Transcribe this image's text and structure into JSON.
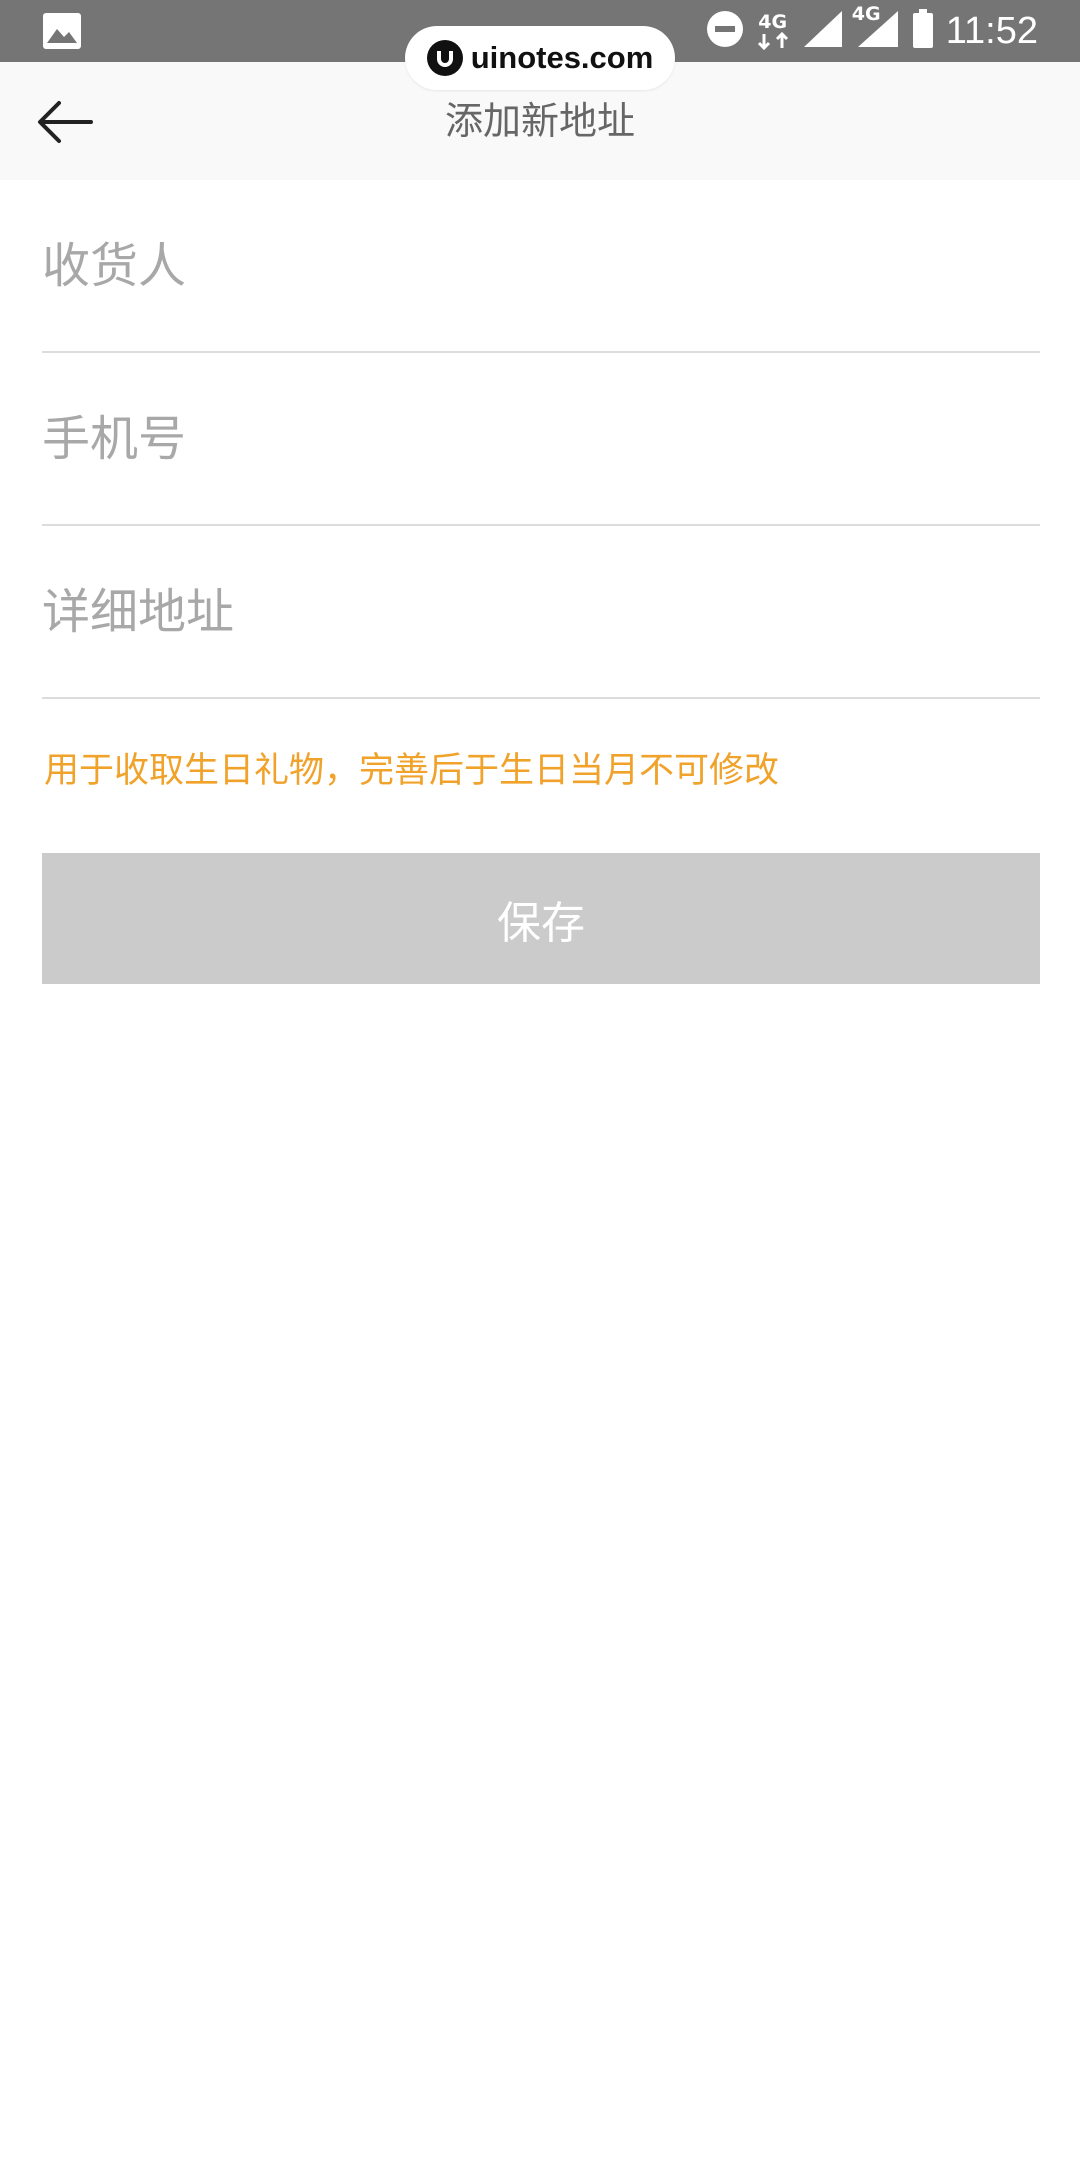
{
  "status_bar": {
    "time": "11:52",
    "network_1": "4G",
    "network_2": "4G",
    "icons": [
      "image-icon",
      "dnd-icon",
      "data-arrows-icon",
      "signal-icon",
      "signal-icon",
      "battery-icon"
    ]
  },
  "watermark": {
    "text": "uinotes.com"
  },
  "app_bar": {
    "title": "添加新地址",
    "back_icon": "back-arrow-icon"
  },
  "form": {
    "recipient_placeholder": "收货人",
    "phone_placeholder": "手机号",
    "address_placeholder": "详细地址",
    "notice": "用于收取生日礼物，完善后于生日当月不可修改",
    "save_label": "保存"
  },
  "colors": {
    "status_bar_bg": "#757575",
    "notice": "#f0a22a",
    "button_disabled": "#cbcbcb"
  }
}
